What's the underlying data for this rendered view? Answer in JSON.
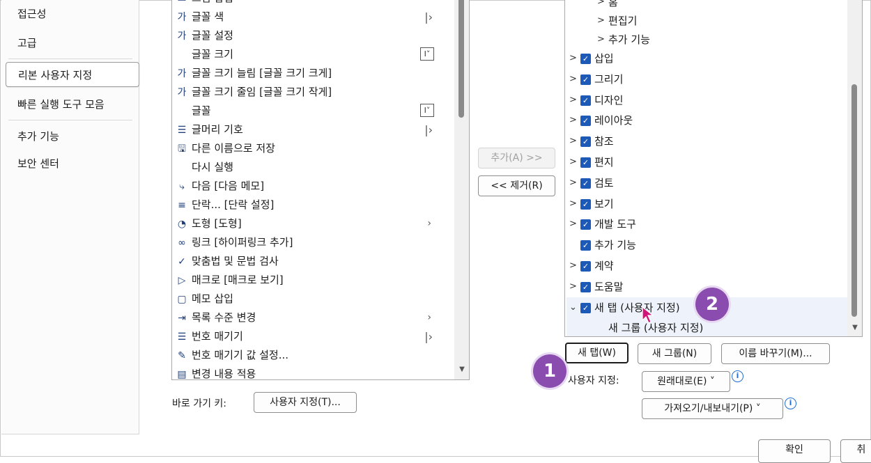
{
  "nav": {
    "items": [
      {
        "label": "접근성"
      },
      {
        "label": "고급"
      },
      {
        "label": "리본 사용자 지정"
      },
      {
        "label": "빠른 실행 도구 모음"
      },
      {
        "label": "추가 기능"
      },
      {
        "label": "보안 센터"
      }
    ]
  },
  "commands": [
    {
      "label": "그림 삽입",
      "icon": "picture-icon"
    },
    {
      "label": "글꼴 색",
      "icon": "font-color-icon",
      "suffix": "split-arrow"
    },
    {
      "label": "글꼴 설정",
      "icon": "font-settings-icon"
    },
    {
      "label": "글꼴 크기",
      "icon": "",
      "suffix": "combo"
    },
    {
      "label": "글꼴 크기 늘림 [글꼴 크기 크게]",
      "icon": "grow-font-icon"
    },
    {
      "label": "글꼴 크기 줄임 [글꼴 크기 작게]",
      "icon": "shrink-font-icon"
    },
    {
      "label": "글꼴",
      "icon": "",
      "suffix": "combo"
    },
    {
      "label": "글머리 기호",
      "icon": "bullets-icon",
      "suffix": "split-arrow"
    },
    {
      "label": "다른 이름으로 저장",
      "icon": "save-as-icon"
    },
    {
      "label": "다시 실행",
      "icon": ""
    },
    {
      "label": "다음 [다음 메모]",
      "icon": "next-comment-icon"
    },
    {
      "label": "단락... [단락 설정]",
      "icon": "paragraph-icon"
    },
    {
      "label": "도형 [도형]",
      "icon": "shapes-icon",
      "suffix": "arrow"
    },
    {
      "label": "링크 [하이퍼링크 추가]",
      "icon": "link-icon"
    },
    {
      "label": "맞춤법 및 문법 검사",
      "icon": "spelling-icon"
    },
    {
      "label": "매크로 [매크로 보기]",
      "icon": "macro-icon"
    },
    {
      "label": "메모 삽입",
      "icon": "comment-icon"
    },
    {
      "label": "목록 수준 변경",
      "icon": "list-level-icon",
      "suffix": "arrow"
    },
    {
      "label": "번호 매기기",
      "icon": "numbering-icon",
      "suffix": "split-arrow"
    },
    {
      "label": "번호 매기기 값 설정...",
      "icon": "numbering-value-icon"
    },
    {
      "label": "변경 내용 적용",
      "icon": "apply-changes-icon"
    }
  ],
  "buttons": {
    "add": "추가(A) >>",
    "remove": "<< 제거(R)",
    "new_tab": "새 탭(W)",
    "new_group": "새 그룹(N)",
    "rename": "이름 바꾸기(M)...",
    "reset": "원래대로(E) ˅",
    "import_export": "가져오기/내보내기(P) ˅",
    "shortcut_customize": "사용자 지정(T)...",
    "ok": "확인",
    "cancel": "취"
  },
  "labels": {
    "shortcut_keys": "바로 가기 키:",
    "customize": "사용자 지정:"
  },
  "tree": {
    "top_items": [
      "홈",
      "편집기",
      "추가 기능"
    ],
    "tabs": [
      {
        "label": "삽입",
        "expand": true,
        "checked": true
      },
      {
        "label": "그리기",
        "expand": true,
        "checked": true
      },
      {
        "label": "디자인",
        "expand": true,
        "checked": true
      },
      {
        "label": "레이아웃",
        "expand": true,
        "checked": true
      },
      {
        "label": "참조",
        "expand": true,
        "checked": true
      },
      {
        "label": "편지",
        "expand": true,
        "checked": true
      },
      {
        "label": "검토",
        "expand": true,
        "checked": true
      },
      {
        "label": "보기",
        "expand": true,
        "checked": true
      },
      {
        "label": "개발 도구",
        "expand": true,
        "checked": true
      },
      {
        "label": "추가 기능",
        "expand": false,
        "checked": true
      },
      {
        "label": "계약",
        "expand": true,
        "checked": true
      },
      {
        "label": "도움말",
        "expand": true,
        "checked": true
      },
      {
        "label": "새 탭 (사용자 지정)",
        "expand": "open",
        "checked": true
      }
    ],
    "new_group": "새 그룹 (사용자 지정)"
  },
  "callouts": [
    "1",
    "2"
  ],
  "colors": {
    "accent": "#1d5ab8",
    "callout": "#8a4cae",
    "cursor": "#d1147a"
  }
}
